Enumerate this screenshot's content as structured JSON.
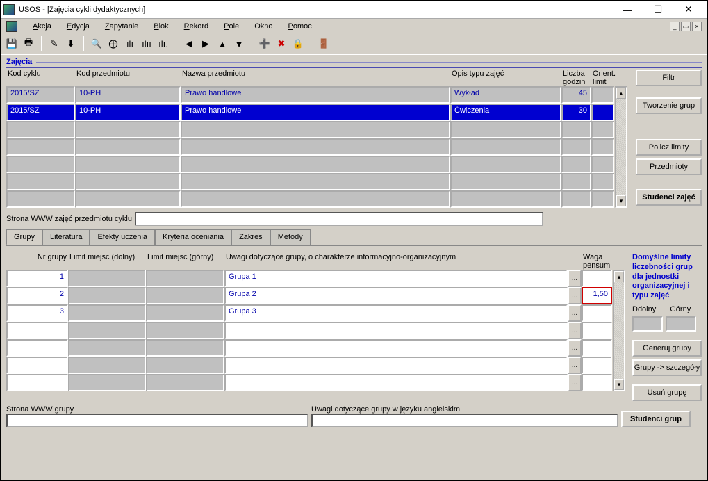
{
  "window": {
    "title": "USOS - [Zajęcia cykli dydaktycznych]"
  },
  "menu": {
    "items": [
      "Akcja",
      "Edycja",
      "Zapytanie",
      "Blok",
      "Rekord",
      "Pole",
      "Okno",
      "Pomoc"
    ]
  },
  "panel": {
    "title": "Zajęcia"
  },
  "columns1": {
    "a": "Kod cyklu",
    "b": "Kod przedmiotu",
    "c": "Nazwa przedmiotu",
    "d": "Opis typu zajęć",
    "e": "Liczba godzin",
    "f": "Orient. limit"
  },
  "rows1": [
    {
      "a": "2015/SZ",
      "b": "10-PH",
      "c": "Prawo handlowe",
      "d": "Wykład",
      "e": "45",
      "f": ""
    },
    {
      "a": "2015/SZ",
      "b": "10-PH",
      "c": "Prawo handlowe",
      "d": "Ćwiczenia",
      "e": "30",
      "f": ""
    },
    {
      "a": "",
      "b": "",
      "c": "",
      "d": "",
      "e": "",
      "f": ""
    },
    {
      "a": "",
      "b": "",
      "c": "",
      "d": "",
      "e": "",
      "f": ""
    },
    {
      "a": "",
      "b": "",
      "c": "",
      "d": "",
      "e": "",
      "f": ""
    },
    {
      "a": "",
      "b": "",
      "c": "",
      "d": "",
      "e": "",
      "f": ""
    },
    {
      "a": "",
      "b": "",
      "c": "",
      "d": "",
      "e": "",
      "f": ""
    }
  ],
  "buttons1": {
    "filter": "Filtr",
    "create_groups": "Tworzenie grup",
    "calc_limits": "Policz limity",
    "subjects": "Przedmioty",
    "students": "Studenci zajęć"
  },
  "www_course_label": "Strona WWW zajęć przedmiotu cyklu",
  "www_course_value": "",
  "tabs": {
    "items": [
      "Grupy",
      "Literatura",
      "Efekty uczenia",
      "Kryteria oceniania",
      "Zakres",
      "Metody"
    ],
    "active": 0
  },
  "columns2": {
    "a": "Nr grupy",
    "b": "Limit miejsc (dolny)",
    "c": "Limit miejsc (górny)",
    "d": "Uwagi dotyczące grupy, o charakterze informacyjno-organizacyjnym",
    "f": "Waga pensum"
  },
  "rows2": [
    {
      "a": "1",
      "b": "",
      "c": "",
      "d": "Grupa 1",
      "f": "",
      "hl": false
    },
    {
      "a": "2",
      "b": "",
      "c": "",
      "d": "Grupa 2",
      "f": "1,50",
      "hl": true
    },
    {
      "a": "3",
      "b": "",
      "c": "",
      "d": "Grupa 3",
      "f": "",
      "hl": false
    },
    {
      "a": "",
      "b": "",
      "c": "",
      "d": "",
      "f": "",
      "hl": false
    },
    {
      "a": "",
      "b": "",
      "c": "",
      "d": "",
      "f": "",
      "hl": false
    },
    {
      "a": "",
      "b": "",
      "c": "",
      "d": "",
      "f": "",
      "hl": false
    },
    {
      "a": "",
      "b": "",
      "c": "",
      "d": "",
      "f": "",
      "hl": false
    }
  ],
  "side2": {
    "help": "Domyślne limity liczebności grup dla jednostki organizacyjnej i typu zajęć",
    "lower": "Ddolny",
    "upper": "Górny",
    "generate": "Generuj grupy",
    "details": "Grupy -> szczegóły",
    "delete": "Usuń grupę"
  },
  "bottom": {
    "www_group": "Strona WWW grupy",
    "www_group_value": "",
    "notes_en": "Uwagi dotyczące grupy w języku angielskim",
    "notes_en_value": "",
    "students": "Studenci grup"
  }
}
